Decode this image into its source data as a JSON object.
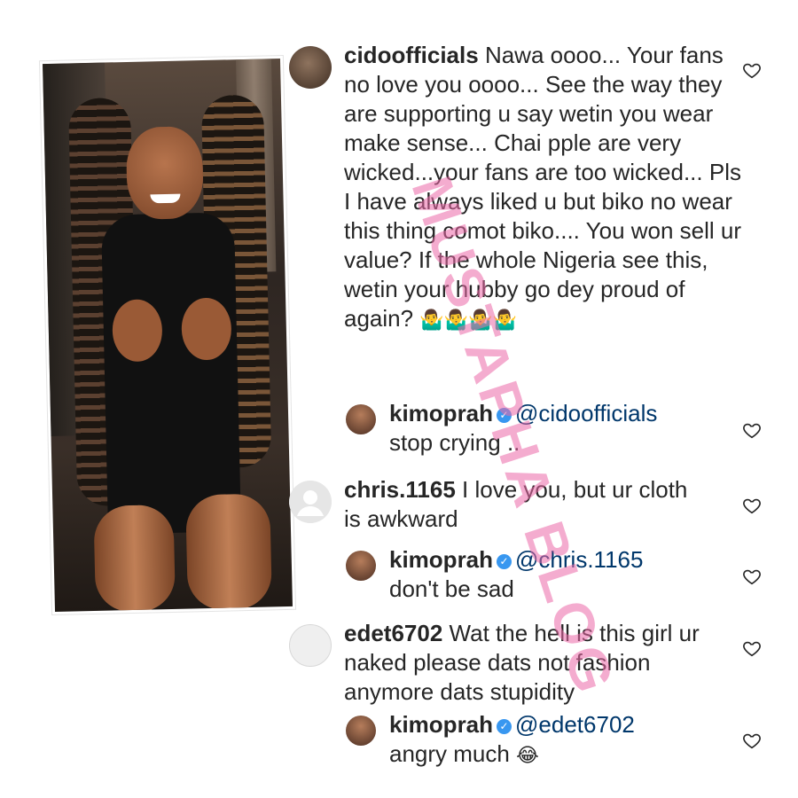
{
  "comments": [
    {
      "username": "cidoofficials",
      "text": "Nawa oooo... Your fans no love you oooo... See the way they are supporting u say wetin you wear make sense... Chai pple are very wicked...your fans are too wicked... Pls I have always liked u but biko no wear this thing comot biko.... You won sell ur value? If the whole Nigeria see this, wetin your hubby go dey proud of again?",
      "emoji": "🤷‍♂️🤷‍♂️🤷‍♂️🤷‍♂️"
    },
    {
      "username": "kimoprah",
      "mention": "@cidoofficials",
      "text": "stop crying .."
    },
    {
      "username": "chris.1165",
      "text": "I love you, but ur cloth is awkward"
    },
    {
      "username": "kimoprah",
      "mention": "@chris.1165",
      "text": "don't be sad"
    },
    {
      "username": "edet6702",
      "text": "Wat the hell is this girl ur naked please dats not fashion anymore dats stupidity"
    },
    {
      "username": "kimoprah",
      "mention": "@edet6702",
      "text": "angry much",
      "emoji": "😂"
    }
  ],
  "icons": {
    "like": "heart-outline-icon",
    "verified": "verified-badge-icon"
  },
  "colors": {
    "mention": "#00376b",
    "verified": "#3897f0",
    "watermark": "#ec6aa8"
  },
  "watermark": "MUSTAPHA BLOG"
}
